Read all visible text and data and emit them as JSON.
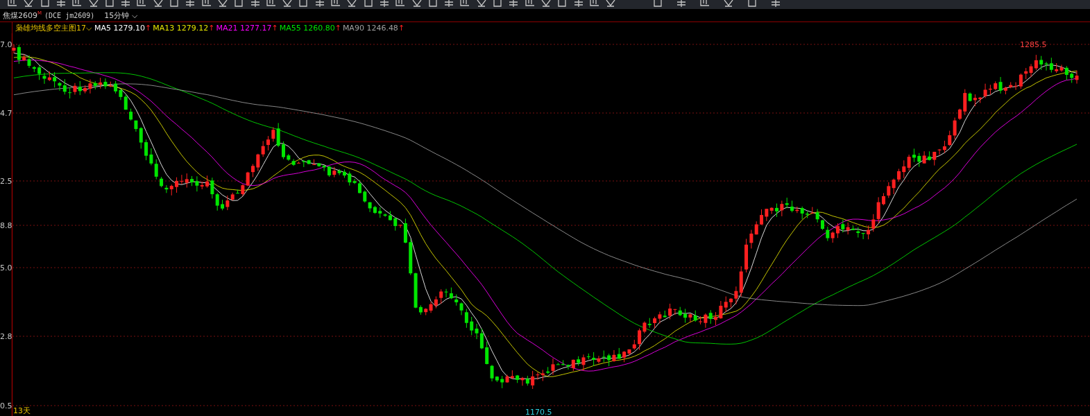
{
  "symbol": {
    "name": "焦煤2609",
    "badge": "M",
    "code": "(DCE jm2609)",
    "period": "15分钟",
    "period_caret": "⌵"
  },
  "indicator": {
    "name": "枭雄均线多空主图",
    "param": "17",
    "caret": "⌵",
    "lines": [
      {
        "label": "MA5",
        "value": "1279.10",
        "arrow": "↑",
        "color": "#ffffff"
      },
      {
        "label": "MA13",
        "value": "1279.12",
        "arrow": "↑",
        "color": "#e6e600"
      },
      {
        "label": "MA21",
        "value": "1277.17",
        "arrow": "↑",
        "color": "#ff00ff"
      },
      {
        "label": "MA55",
        "value": "1260.80",
        "arrow": "↑",
        "color": "#00e600"
      },
      {
        "label": "MA90",
        "value": "1246.48",
        "arrow": "↑",
        "color": "#a0a0a0"
      }
    ]
  },
  "y_axis_labels": [
    "7.0",
    "4.7",
    "2.5",
    "8.8",
    "5.0",
    "2.8",
    "0.5"
  ],
  "high_marker": "1285.5",
  "low_marker": "1170.5",
  "bottom_label": "13天"
}
